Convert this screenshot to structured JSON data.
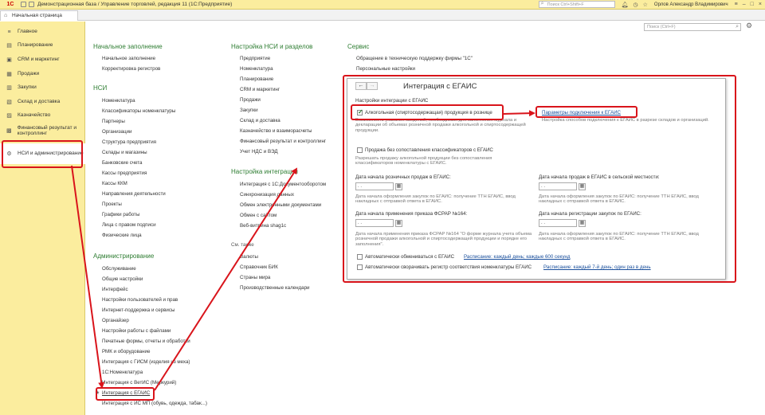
{
  "app": {
    "logo": "1С",
    "title": "Демонстрационная база / Управление торговлей, редакция 11  (1С:Предприятие)",
    "search_placeholder": "Поиск Ctrl+Shift+F",
    "user": "Орлов Александр Владимирович"
  },
  "tabs": {
    "home": "Начальная страница"
  },
  "sidebar": {
    "items": [
      {
        "label": "Главное",
        "icon": "menu-icon"
      },
      {
        "label": "Планирование",
        "icon": "planning-icon"
      },
      {
        "label": "CRM и маркетинг",
        "icon": "crm-icon"
      },
      {
        "label": "Продажи",
        "icon": "sales-icon"
      },
      {
        "label": "Закупки",
        "icon": "purchases-icon"
      },
      {
        "label": "Склад и доставка",
        "icon": "warehouse-icon"
      },
      {
        "label": "Казначейство",
        "icon": "treasury-icon"
      },
      {
        "label": "Финансовый результат и контроллинг",
        "icon": "finance-icon"
      },
      {
        "label": "НСИ и администрирование",
        "icon": "gear-icon"
      }
    ]
  },
  "main": {
    "search_placeholder": "Поиск (Ctrl+F)",
    "col1": {
      "sections": [
        {
          "title": "Начальное заполнение",
          "items": [
            "Начальное заполнение",
            "Корректировка регистров"
          ]
        },
        {
          "title": "НСИ",
          "items": [
            "Номенклатура",
            "Классификаторы номенклатуры",
            "Партнеры",
            "Организации",
            "Структура предприятия",
            "Склады и магазины",
            "Банковские счета",
            "Кассы предприятия",
            "Кассы ККМ",
            "Направления деятельности",
            "Проекты",
            "Графики работы",
            "Лица с правом подписи",
            "Физические лица"
          ]
        },
        {
          "title": "Администрирование",
          "items": [
            "Обслуживание",
            "Общие настройки",
            "Интерфейс",
            "Настройки пользователей и прав",
            "Интернет-поддержка и сервисы",
            "Органайзер",
            "Настройки работы с файлами",
            "Печатные формы, отчеты и обработки",
            "РМК и оборудование",
            "Интеграция с ГИСМ (изделия из меха)",
            "1С:Номенклатура",
            "Интеграция с ВетИС (Меркурий)",
            "Интеграция с ЕГАИС",
            "Интеграция с ИС МП (обувь, одежда, табак...)"
          ]
        }
      ]
    },
    "col2": {
      "sections": [
        {
          "title": "Настройка НСИ и разделов",
          "items": [
            "Предприятие",
            "Номенклатура",
            "Планирование",
            "CRM и маркетинг",
            "Продажи",
            "Закупки",
            "Склад и доставка",
            "Казначейство и взаиморасчеты",
            "Финансовый результат и контроллинг",
            "Учет НДС и ВЭД"
          ]
        },
        {
          "title": "Настройка интеграции",
          "items": [
            "Интеграция с 1С:Документооборотом",
            "Синхронизация данных",
            "Обмен электронными документами",
            "Обмен с сайтом",
            "Веб-витрина shag1c"
          ]
        }
      ],
      "see_also_title": "См. также",
      "see_also": [
        "Валюты",
        "Справочник БИК",
        "Страны мира",
        "Производственные календари"
      ]
    },
    "col3": {
      "title": "Сервис",
      "items": [
        "Обращение в техническую поддержку фирмы \"1С\"",
        "Персональные настройки"
      ]
    }
  },
  "dialog": {
    "title": "Интеграция с ЕГАИС",
    "group_title": "Настройки интеграции с ЕГАИС",
    "alcohol_retail": {
      "label": "Алкогольная (спиртосодержащая) продукция в рознице",
      "checked": true,
      "hint": "Возможность указания сведений, необходимых для заполнения журнала и декларации об объемах розничной продажи алкогольной и спиртосодержащей продукции."
    },
    "connection_link": "Параметры подключения к ЕГАИС",
    "connection_hint": "Настройка способов подключения к ЕГАИС в разрезе складов и организаций.",
    "no_classifier": {
      "label": "Продажа без сопоставления классификаторов с ЕГАИС",
      "checked": false,
      "hint": "Разрешать продажу алкогольной продукции без сопоставления классификаторов номенклатуры с ЕГАИС."
    },
    "retail_start": {
      "label": "Дата начала розничных продаж в ЕГАИС:",
      "value": " .  .",
      "hint": "Дата начала оформления закупок по ЕГАИС: получение ТТН ЕГАИС, ввод накладных с отправкой ответа в ЕГАИС."
    },
    "rural_start": {
      "label": "Дата начала продаж в ЕГАИС в сельской местности:",
      "value": " .  .",
      "hint": "Дата начала оформления закупок по ЕГАИС: получение ТТН ЕГАИС, ввод накладных с отправкой ответа в ЕГАИС."
    },
    "order_start": {
      "label": "Дата начала применения приказа ФСРАР №164:",
      "value": " .  .",
      "hint": "Дата начала применения приказа ФСРАР №164 \"О форме журнала учета объема розничной продажи алкогольной и спиртосодержащей продукции и порядке его заполнения\"."
    },
    "purchase_reg_start": {
      "label": "Дата начала регистрации закупок по ЕГАИС:",
      "value": " .  .",
      "hint": "Дата начала оформления закупок по ЕГАИС: получение ТТН ЕГАИС, ввод накладных с отправкой ответа в ЕГАИС."
    },
    "auto_exchange": {
      "label": "Автоматически обмениваться с ЕГАИС",
      "checked": false,
      "schedule": "Расписание: каждый день; каждые 600 секунд"
    },
    "auto_collapse": {
      "label": "Автоматически сворачивать регистр соответствия номенклатуры ЕГАИС",
      "checked": false,
      "schedule": "Расписание: каждый 7-й день; один раз в день"
    }
  },
  "colors": {
    "accent_red": "#d9141b",
    "section_green": "#2e7d32",
    "sidebar_bg": "#fbed9e",
    "link_blue": "#1a4f9c"
  }
}
